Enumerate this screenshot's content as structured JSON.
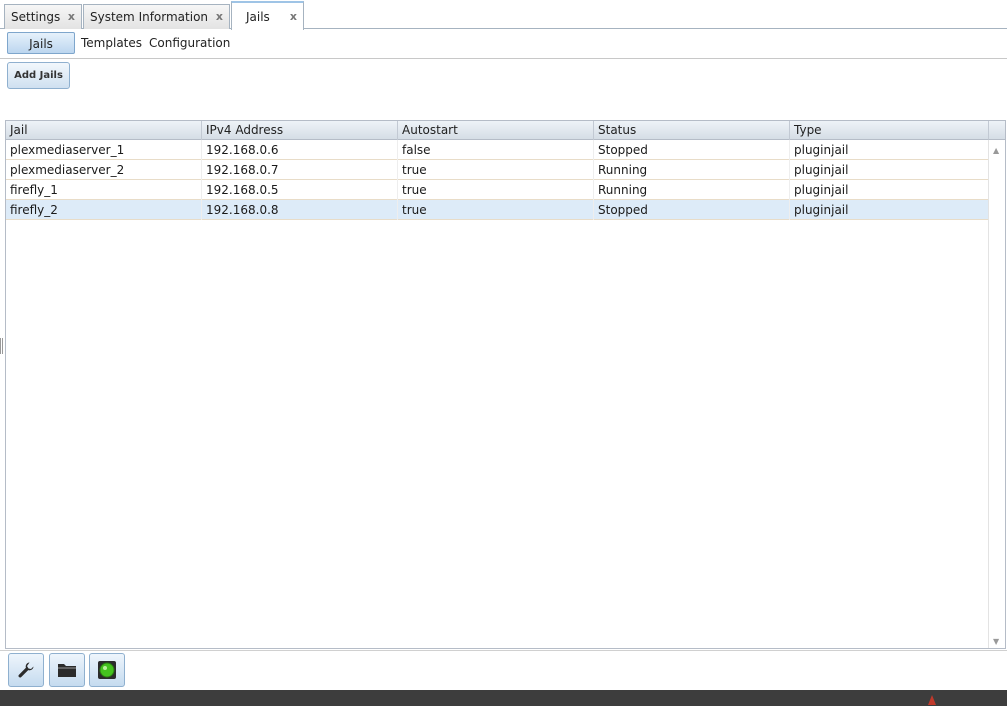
{
  "tabs": [
    {
      "label": "Settings",
      "close": "x"
    },
    {
      "label": "System Information",
      "close": "x"
    },
    {
      "label": "Jails",
      "close": "x"
    }
  ],
  "subtabs": {
    "jails": "Jails",
    "templates": "Templates",
    "configuration": "Configuration"
  },
  "add_button": "Add Jails",
  "grid": {
    "headers": {
      "jail": "Jail",
      "ipv4": "IPv4 Address",
      "autostart": "Autostart",
      "status": "Status",
      "type": "Type"
    },
    "rows": [
      {
        "jail": "plexmediaserver_1",
        "ipv4": "192.168.0.6",
        "autostart": "false",
        "status": "Stopped",
        "type": "pluginjail"
      },
      {
        "jail": "plexmediaserver_2",
        "ipv4": "192.168.0.7",
        "autostart": "true",
        "status": "Running",
        "type": "pluginjail"
      },
      {
        "jail": "firefly_1",
        "ipv4": "192.168.0.5",
        "autostart": "true",
        "status": "Running",
        "type": "pluginjail"
      },
      {
        "jail": "firefly_2",
        "ipv4": "192.168.0.8",
        "autostart": "true",
        "status": "Stopped",
        "type": "pluginjail"
      }
    ]
  },
  "toolbar_icons": [
    "wrench-icon",
    "folder-icon",
    "green-light-icon"
  ],
  "colors": {
    "selected_row": "#ddebf8",
    "active_subtab": "#bcd6ef",
    "status_green": "#44c21e"
  }
}
